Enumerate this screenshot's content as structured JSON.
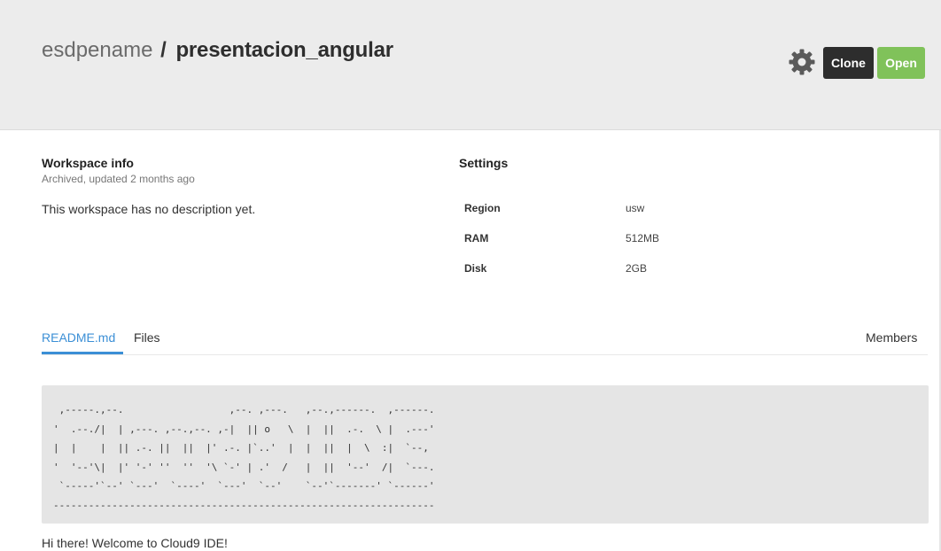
{
  "header": {
    "owner": "esdpename",
    "separator": "/",
    "repo": "presentacion_angular",
    "clone_label": "Clone",
    "open_label": "Open",
    "settings_icon": "gear-icon"
  },
  "workspace_info": {
    "title": "Workspace info",
    "status": "Archived, updated 2 months ago",
    "description": "This workspace has no description yet."
  },
  "settings": {
    "title": "Settings",
    "rows": [
      {
        "label": "Region",
        "value": "usw"
      },
      {
        "label": "RAM",
        "value": "512MB"
      },
      {
        "label": "Disk",
        "value": "2GB"
      }
    ]
  },
  "tabs": {
    "readme": "README.md",
    "files": "Files",
    "members": "Members",
    "active": "README.md"
  },
  "readme": {
    "ascii_art": " ,-----.,--.                  ,--. ,---.   ,--.,------.  ,------.\n'  .--./|  | ,---. ,--.,--. ,-|  || o   \\  |  ||  .-.  \\ |  .---'\n|  |    |  || .-. ||  ||  |' .-. |`..'  |  |  ||  |  \\  :|  `--, \n'  '--'\\|  |' '-' ''  ''  '\\ `-' | .'  /   |  ||  '--'  /|  `---.\n `-----'`--' `---'  `----'  `---'  `--'    `--'`-------' `------'\n-----------------------------------------------------------------",
    "welcome": "Hi there! Welcome to Cloud9 IDE!"
  },
  "colors": {
    "header_bg": "#ececec",
    "clone_bg": "#2d2d2d",
    "open_bg": "#80c25a",
    "accent": "#3b8fd6"
  }
}
